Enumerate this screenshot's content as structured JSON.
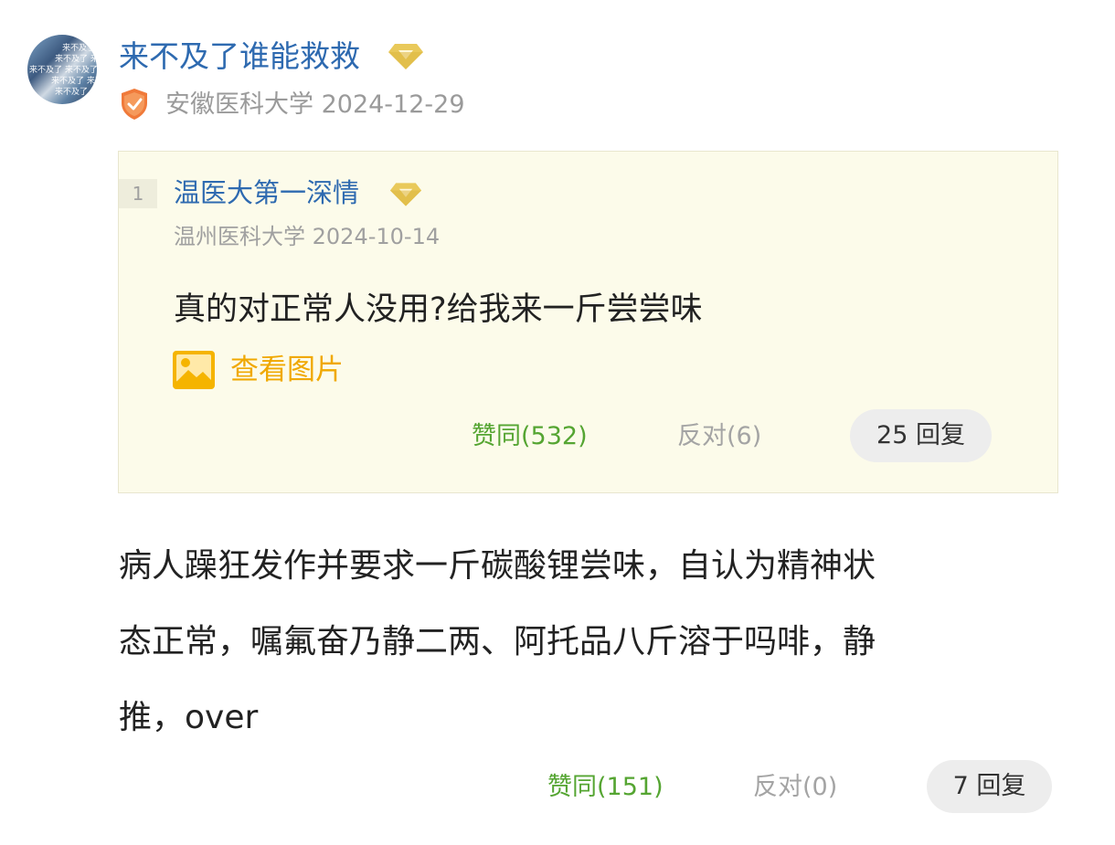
{
  "comment": {
    "avatar_text": [
      "来不及了",
      "来不及了 来不及了",
      "来不及了 来不及了",
      "来不及了 来不及",
      "来不及了 来不及"
    ],
    "username": "来不及了谁能救救",
    "school": "安徽医科大学",
    "date": "2024-12-29",
    "content_lines": [
      "病人躁狂发作并要求一斤碳酸锂尝味，自认为精神状",
      "态正常，嘱氟奋乃静二两、阿托品八斤溶于吗啡，静",
      "推，over"
    ],
    "agree_label": "赞同(151)",
    "oppose_label": "反对(0)",
    "reply_label": "7 回复"
  },
  "quote": {
    "floor": "1",
    "username": "温医大第一深情",
    "school": "温州医科大学",
    "date": "2024-10-14",
    "content": "真的对正常人没用?给我来一斤尝尝味",
    "view_image_label": "查看图片",
    "agree_label": "赞同(532)",
    "oppose_label": "反对(6)",
    "reply_label": "25 回复"
  },
  "colors": {
    "username": "#2e6ab0",
    "agree": "#55a532",
    "view_image": "#f0a800",
    "quote_bg": "#fcfbea"
  },
  "icons": [
    "diamond-badge-icon",
    "shield-verified-icon",
    "image-icon"
  ]
}
